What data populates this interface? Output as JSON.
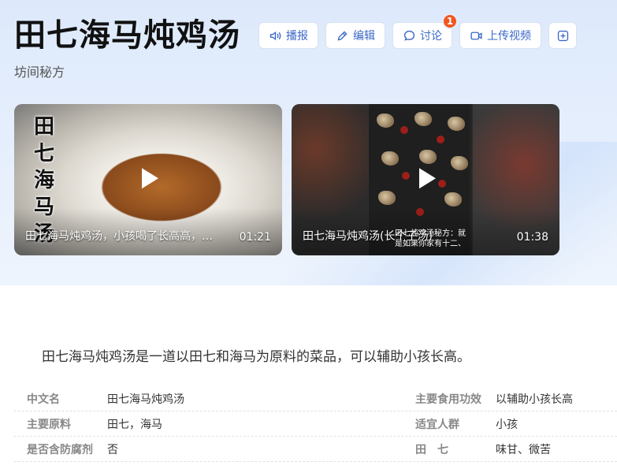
{
  "title": "田七海马炖鸡汤",
  "subtitle": "坊间秘方",
  "actions": [
    {
      "label": "播报"
    },
    {
      "label": "编辑"
    },
    {
      "label": "讨论",
      "badge": "1"
    },
    {
      "label": "上传视频"
    }
  ],
  "videos": [
    {
      "thumb_text": "田七海马汤",
      "caption": "田七海马炖鸡汤，小孩喝了长高高，…",
      "duration": "01:21"
    },
    {
      "caption": "田七海马炖鸡汤(长个子汤)",
      "overlay_text": "田七炖鸡汤秘方：就是如果你家有十二、",
      "duration": "01:38"
    }
  ],
  "summary": "田七海马炖鸡汤是一道以田七和海马为原料的菜品，可以辅助小孩长高。",
  "info": [
    {
      "k1": "中文名",
      "v1": "田七海马炖鸡汤",
      "k2": "主要食用功效",
      "v2": "以辅助小孩长高"
    },
    {
      "k1": "主要原料",
      "v1": "田七，海马",
      "k2": "适宜人群",
      "v2": "小孩"
    },
    {
      "k1": "是否含防腐剂",
      "v1": "否",
      "k2": "田　七",
      "v2": "味甘、微苦"
    }
  ],
  "colors": {
    "accent": "#3b68c7",
    "badge": "#f2561d",
    "hero_bg": "#dde9fb"
  }
}
